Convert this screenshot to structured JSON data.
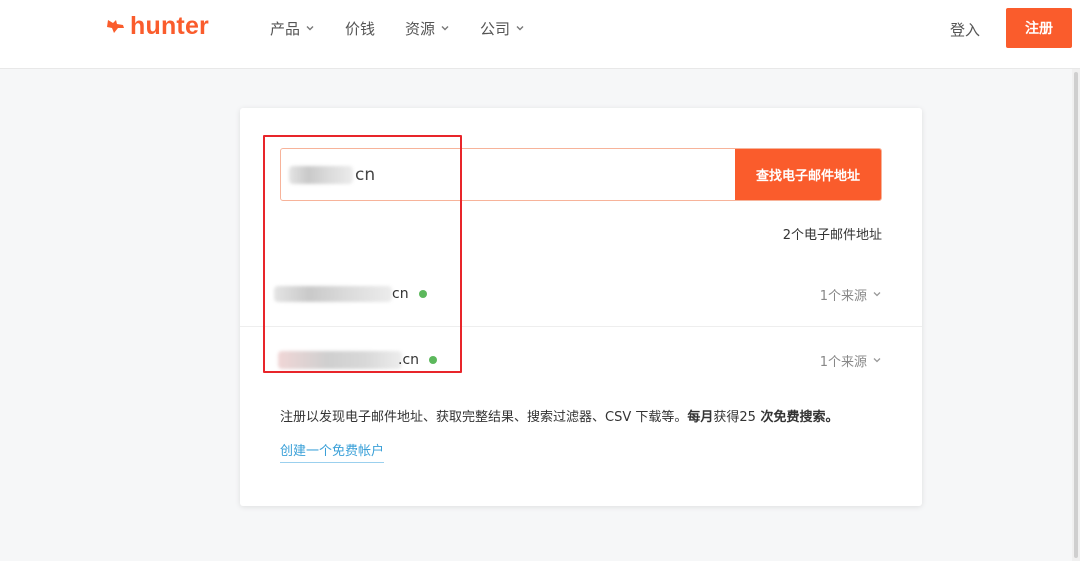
{
  "brand": {
    "name": "hunter",
    "color": "#fa5c2c"
  },
  "nav": {
    "items": [
      {
        "label": "产品",
        "dropdown": true
      },
      {
        "label": "价钱",
        "dropdown": false
      },
      {
        "label": "资源",
        "dropdown": true
      },
      {
        "label": "公司",
        "dropdown": true
      }
    ],
    "login_label": "登入",
    "signup_label": "注册"
  },
  "search": {
    "domain_value_visible": "cn",
    "button_label": "查找电子邮件地址"
  },
  "results": {
    "count_text": "2个电子邮件地址",
    "emails": [
      {
        "visible_suffix": "cn",
        "status": "verified",
        "sources_label": "1个来源"
      },
      {
        "visible_suffix": ".cn",
        "status": "verified",
        "sources_label": "1个来源"
      }
    ]
  },
  "cta": {
    "text_normal": "注册以发现电子邮件地址、获取完整结果、搜索过滤器、CSV 下载等。",
    "text_bold_1": "每月",
    "text_normal_2": "获得25",
    "text_bold_2": " 次免费搜索。",
    "link_label": "创建一个免费帐户"
  },
  "colors": {
    "accent": "#fa5c2c",
    "verified": "#5cb85c",
    "link": "#3aa0d8",
    "highlight": "#e8252a"
  }
}
